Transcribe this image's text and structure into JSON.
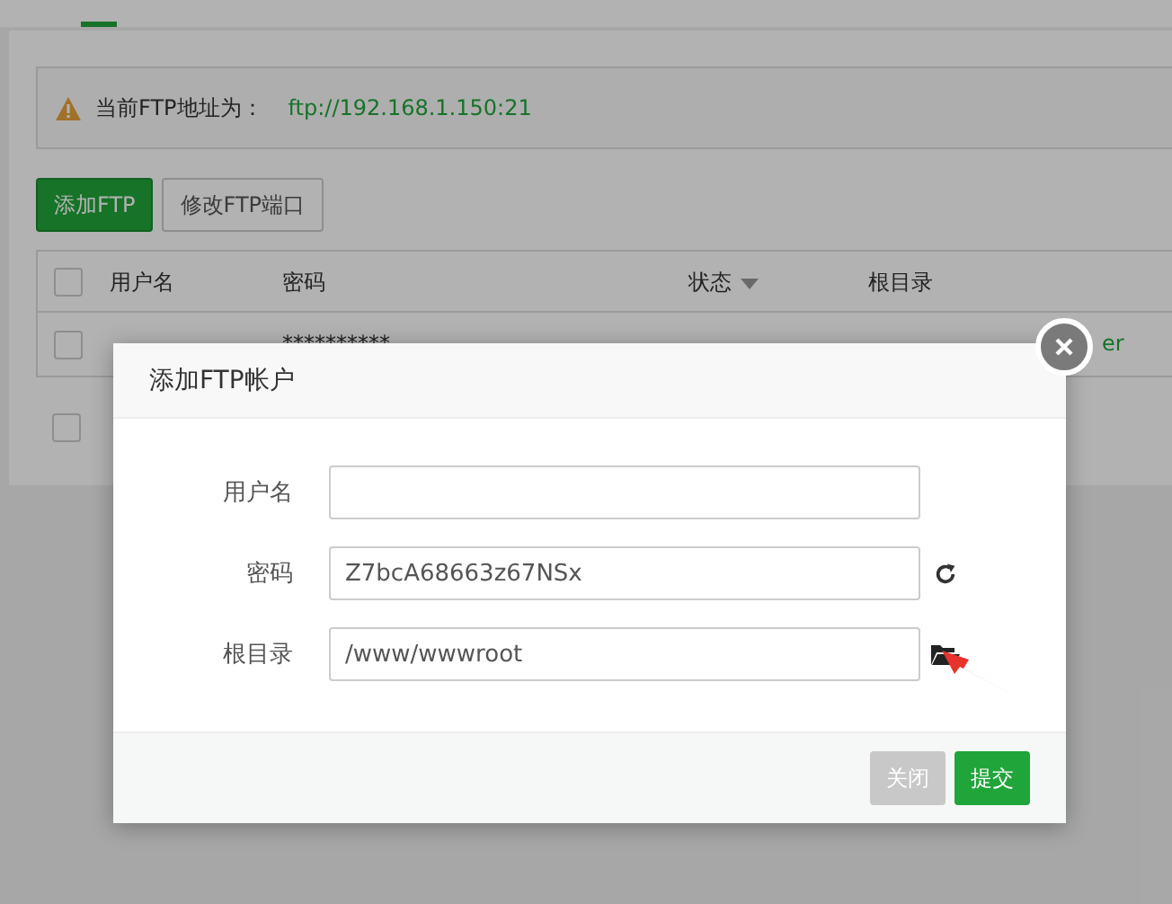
{
  "alert": {
    "label": "当前FTP地址为：",
    "address": "ftp://192.168.1.150:21"
  },
  "toolbar": [
    {
      "label": "添加FTP",
      "kind": "primary"
    },
    {
      "label": "修改FTP端口",
      "kind": "default"
    }
  ],
  "table": {
    "header_checked": false,
    "columns": [
      "用户名",
      "密码",
      "状态",
      "根目录"
    ],
    "rows": [
      {
        "checked": false,
        "password": "**********",
        "column_6": "er"
      }
    ],
    "footer": {
      "checked": false
    }
  },
  "dialog": {
    "title": "添加FTP帐户",
    "fields": [
      {
        "label": "用户名",
        "kind": "plain"
      },
      {
        "label": "密码",
        "value": "Z7bcA68663z67NSx",
        "kind": "refresh"
      },
      {
        "label": "根目录",
        "value": "/www/wwwroot",
        "kind": "folder"
      }
    ],
    "buttons": [
      {
        "label": "关闭",
        "kind": "default"
      },
      {
        "label": "提交",
        "kind": "primary"
      }
    ]
  }
}
